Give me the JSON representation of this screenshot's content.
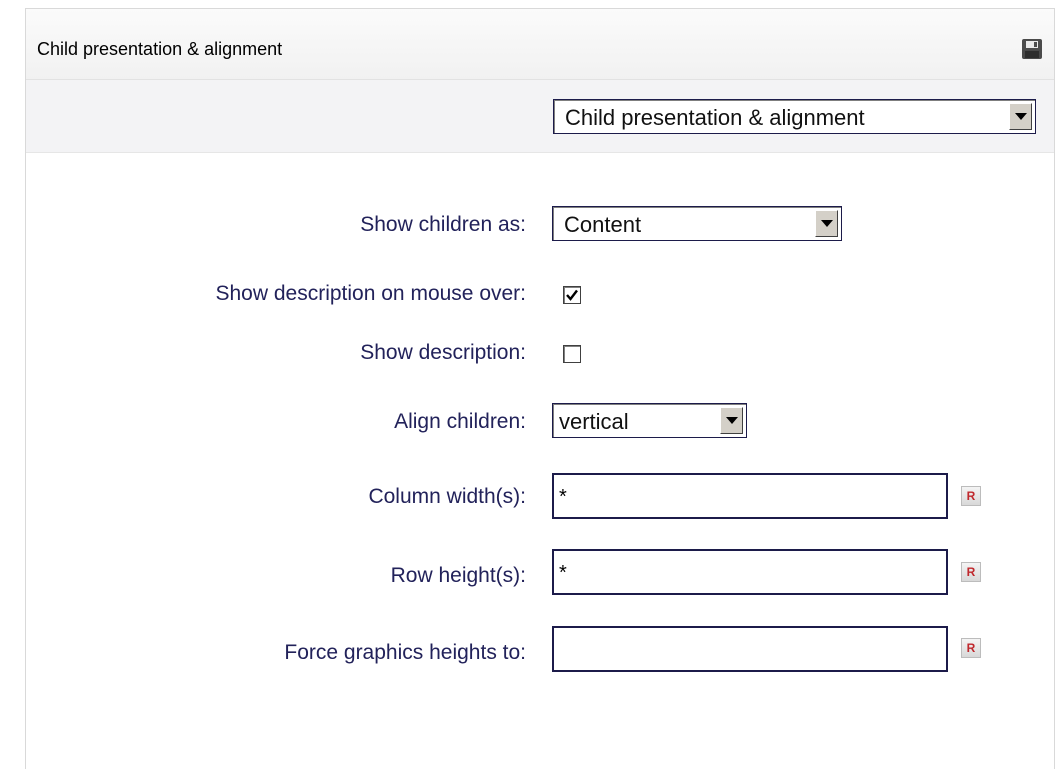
{
  "panel": {
    "title": "Child presentation & alignment",
    "save_icon": "floppy-disk-icon",
    "section_select": {
      "selected": "Child presentation & alignment"
    }
  },
  "form": {
    "show_children_as": {
      "label": "Show children as:",
      "value": "Content"
    },
    "show_description_mouse_over": {
      "label": "Show description on mouse over:",
      "checked": true
    },
    "show_description": {
      "label": "Show description:",
      "checked": false
    },
    "align_children": {
      "label": "Align children:",
      "value": "vertical"
    },
    "column_widths": {
      "label": "Column width(s):",
      "value": "*",
      "reset_label": "R"
    },
    "row_heights": {
      "label": "Row height(s):",
      "value": "*",
      "reset_label": "R"
    },
    "force_graphics_heights": {
      "label": "Force graphics heights to:",
      "value": "",
      "reset_label": "R"
    }
  },
  "colors": {
    "label_text": "#22225a",
    "input_border": "#1c1b4a",
    "reset_text": "#c0282d"
  }
}
